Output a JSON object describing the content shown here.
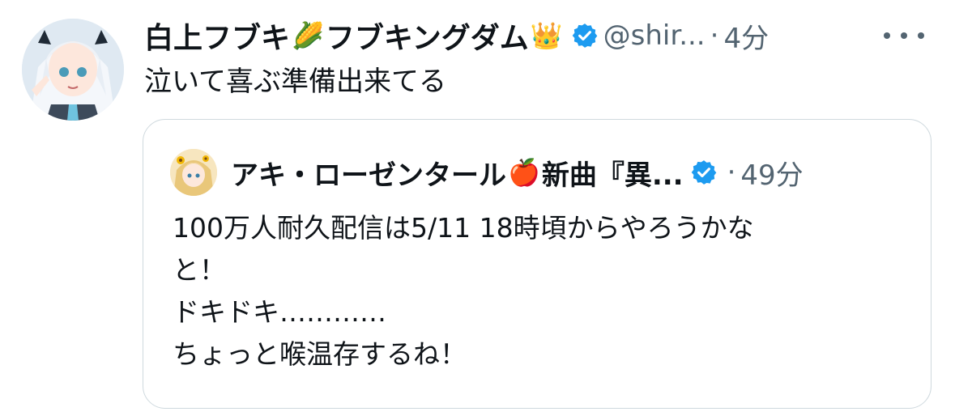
{
  "tweet": {
    "display_name_part1": "白上フブキ",
    "emoji_1": "🌽",
    "display_name_part2": "フブキングダム",
    "emoji_2": "👑",
    "handle": "@shir...",
    "separator": "·",
    "time": "4分",
    "text": "泣いて喜ぶ準備出来てる",
    "avatar_icon": "avatar-fubuki-icon",
    "verified_icon": "verified-badge-icon",
    "more_icon": "more-options-icon"
  },
  "quoted_tweet": {
    "display_name_part1": "アキ・ローゼンタール",
    "emoji": "🍎",
    "display_name_part2": "新曲『異...",
    "separator": "·",
    "time": "49分",
    "text_lines": [
      "100万人耐久配信は5/11 18時頃からやろうかな",
      "と！",
      "ドキドキ…………",
      "ちょっと喉温存するね！"
    ],
    "avatar_icon": "avatar-aki-icon",
    "verified_icon": "verified-badge-icon"
  },
  "colors": {
    "text_primary": "#0f1419",
    "text_secondary": "#536471",
    "verified_blue": "#1d9bf0",
    "border": "#cfd9de"
  }
}
